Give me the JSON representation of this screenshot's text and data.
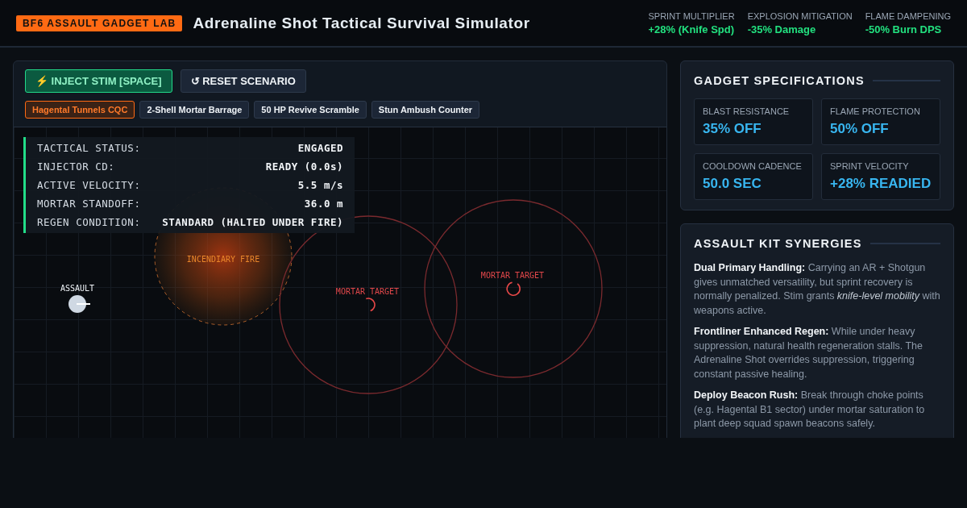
{
  "header": {
    "badge": "BF6 ASSAULT GADGET LAB",
    "title": "Adrenaline Shot Tactical Survival Simulator",
    "stats": [
      {
        "label": "SPRINT MULTIPLIER",
        "value": "+28% (Knife Spd)"
      },
      {
        "label": "EXPLOSION MITIGATION",
        "value": "-35% Damage"
      },
      {
        "label": "FLAME DAMPENING",
        "value": "-50% Burn DPS"
      }
    ]
  },
  "controls": {
    "buttons": [
      {
        "kind": "primary",
        "label": "⚡ INJECT STIM [SPACE]"
      },
      {
        "kind": "secondary",
        "label": "↺ RESET SCENARIO"
      }
    ],
    "scenarios": [
      {
        "label": "Hagental Tunnels CQC",
        "selected": true
      },
      {
        "label": "2-Shell Mortar Barrage",
        "selected": false
      },
      {
        "label": "50 HP Revive Scramble",
        "selected": false
      },
      {
        "label": "Stun Ambush Counter",
        "selected": false
      }
    ]
  },
  "map": {
    "status": [
      {
        "label": "TACTICAL STATUS:",
        "value": "ENGAGED"
      },
      {
        "label": "INJECTOR CD:",
        "value": "READY (0.0s)"
      },
      {
        "label": "ACTIVE VELOCITY:",
        "value": "5.5 m/s"
      },
      {
        "label": "MORTAR STANDOFF:",
        "value": "36.0 m"
      },
      {
        "label": "REGEN CONDITION:",
        "value": "STANDARD (HALTED UNDER FIRE)"
      }
    ],
    "markers": [
      {
        "kind": "fire",
        "label": "INCENDIARY FIRE"
      },
      {
        "kind": "player",
        "label": "ASSAULT"
      },
      {
        "kind": "mortar",
        "label": "MORTAR TARGET"
      },
      {
        "kind": "mortar",
        "label": "MORTAR TARGET"
      }
    ]
  },
  "specs": {
    "title": "GADGET SPECIFICATIONS",
    "items": [
      {
        "label": "BLAST RESISTANCE",
        "value": "35% OFF"
      },
      {
        "label": "FLAME PROTECTION",
        "value": "50% OFF"
      },
      {
        "label": "COOLDOWN CADENCE",
        "value": "50.0 SEC"
      },
      {
        "label": "SPRINT VELOCITY",
        "value": "+28% READIED"
      }
    ]
  },
  "synergies": {
    "title": "ASSAULT KIT SYNERGIES",
    "items": [
      "**Dual Primary Handling:** Carrying an AR + Shotgun gives unmatched versatility, but sprint recovery is normally penalized. Stim grants *knife-level mobility* with weapons active.",
      "**Frontliner Enhanced Regen:** While under heavy suppression, natural health regeneration stalls. The Adrenaline Shot overrides suppression, triggering constant passive healing.",
      "**Deploy Beacon Rush:** Break through choke points (e.g. Hagental B1 sector) under mortar saturation to plant deep squad spawn beacons safely."
    ]
  }
}
